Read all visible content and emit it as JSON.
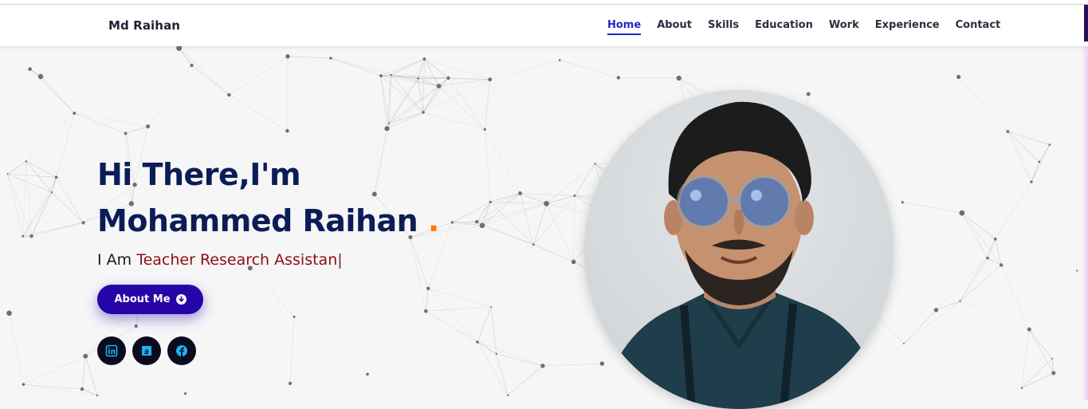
{
  "navbar": {
    "brand": "Md Raihan",
    "links": [
      "Home",
      "About",
      "Skills",
      "Education",
      "Work",
      "Experience",
      "Contact"
    ],
    "active": "Home"
  },
  "hero": {
    "greeting": "Hi There,I'm",
    "name": "Mohammed Raihan",
    "name_dot": ".",
    "intro_prefix": "I Am",
    "role_text": "Teacher Research Assistan",
    "cursor": "|",
    "about_button": "About Me",
    "about_button_icon": "arrow-circle-down-icon"
  },
  "socials": [
    {
      "name": "linkedin-icon"
    },
    {
      "name": "stackoverflow-icon"
    },
    {
      "name": "facebook-icon"
    }
  ],
  "portrait": {
    "icon": "profile-photo"
  },
  "colors": {
    "title": "#0b1d57",
    "accent_dot": "#ff7a00",
    "role": "#8c0f13",
    "button": "#2505a8",
    "nav_active": "#2328c6",
    "social_icon": "#19b5f2"
  }
}
